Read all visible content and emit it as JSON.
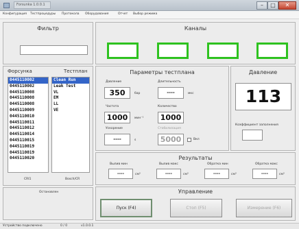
{
  "window": {
    "title": "Forsunka 1.0.0.1"
  },
  "menu": [
    "Конфигурация",
    "Тестпроцедуры",
    "Протокола",
    "Оборудования",
    "Отчет",
    "Выбор режима"
  ],
  "filter": {
    "title": "Фильтр",
    "value": ""
  },
  "channels": {
    "title": "Каналы",
    "count": 4,
    "color": "#2ec21f"
  },
  "list": {
    "col_nozzle": "Форсунка",
    "col_test": "Тестплан",
    "nozzles": [
      "0445110002",
      "0445110002",
      "0445110008",
      "0445110008",
      "0445110008",
      "0445110009",
      "0445110010",
      "0445110011",
      "0445110012",
      "0445110014",
      "0445110015",
      "0445110019",
      "0445110019",
      "0445110020"
    ],
    "tests": [
      "Clean Run",
      "Leak Test",
      "VL",
      "EM",
      "LL",
      "VE"
    ],
    "footer_left": "CRI1",
    "footer_right": "Bosch/CR"
  },
  "params": {
    "title": "Параметры тестплана",
    "pressure_label": "Давление",
    "pressure_value": "350",
    "pressure_unit": "бар",
    "duration_label": "Длительность",
    "duration_value": "----",
    "duration_unit": "мкс",
    "freq_label": "Частота",
    "freq_value": "1000",
    "freq_unit": "мин⁻¹",
    "count_label": "Количество",
    "count_value": "1000",
    "stab_label": "Стабилизация",
    "stab_value": "5000",
    "stab_check_label": "Вкл",
    "accel_label": "Ускорение",
    "accel_value": "----",
    "accel_unit": "s"
  },
  "pressure": {
    "title": "Давление",
    "value": "113",
    "coef_label": "Коэффициент заполнения",
    "coef_value": ""
  },
  "results": {
    "title": "Результаты",
    "items": [
      {
        "label": "Вылив мин",
        "value": "----",
        "unit": "см³"
      },
      {
        "label": "Вылив макс",
        "value": "----",
        "unit": "см³"
      },
      {
        "label": "Обратка мин",
        "value": "----",
        "unit": "см³"
      },
      {
        "label": "Обратка макс",
        "value": "----",
        "unit": "см³"
      }
    ]
  },
  "notes": {
    "label": "Остановлен"
  },
  "control": {
    "title": "Управление",
    "start": "Пуск (F4)",
    "stop": "Стоп (F5)",
    "measure": "Измерение (F6)"
  },
  "status": {
    "left": "Устройство подключено",
    "mid": "0 / 0",
    "right": "v1.0.0.1"
  }
}
